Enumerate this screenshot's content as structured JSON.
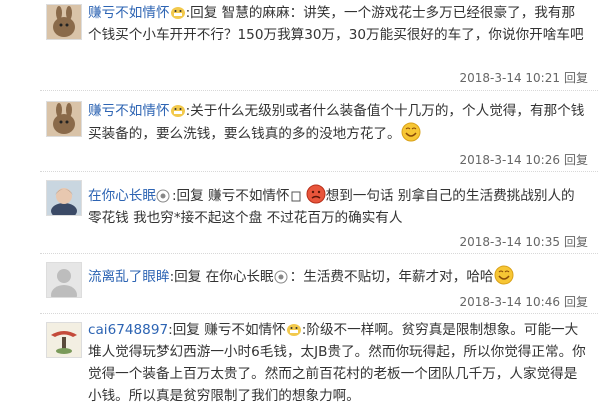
{
  "replies": [
    {
      "user": "赚亏不如情怀",
      "text_a": ":回复 智慧的麻麻：讲笑，一个游戏花士多万已经很豪了，我有那个钱买个小车开开不行？150万我算30万，30万能买很好的车了，你说你开啥车吧",
      "time": "2018-3-14 10:21",
      "reply_label": "回复"
    },
    {
      "user": "赚亏不如情怀",
      "text_a": ":关于什么无级别或者什么装备值个十几万的，个人觉得，有那个钱买装备的，要么洗钱，要么钱真的多的没地方花了。",
      "time": "2018-3-14 10:26",
      "reply_label": "回复"
    },
    {
      "user": "在你心长眠",
      "text_a": ":回复 赚亏不如情怀",
      "text_b": "想到一句话 别拿自己的生活费挑战别人的零花钱 我也穷*接不起这个盘 不过花百万的确实有人",
      "time": "2018-3-14 10:35",
      "reply_label": "回复"
    },
    {
      "user": "流离乱了眼眸",
      "text_a": ":回复 在你心长眠",
      "text_b": "：生活费不贴切，年薪才对，哈哈",
      "time": "2018-3-14 10:46",
      "reply_label": "回复"
    },
    {
      "user": "cai6748897",
      "text_a": ":回复 赚亏不如情怀",
      "text_b": ":阶级不一样啊。贫穷真是限制想象。可能一大堆人觉得玩梦幻西游一小时6毛钱，太JB贵了。然而你玩得起，所以你觉得正常。你觉得一个装备上百万太贵了。然而之前百花村的老板一个团队几千万，人家觉得是小钱。所以真是贫穷限制了我们的想象力啊。"
    }
  ],
  "colors": {
    "username": "#2d64b3",
    "text": "#333333",
    "meta": "#666666"
  }
}
